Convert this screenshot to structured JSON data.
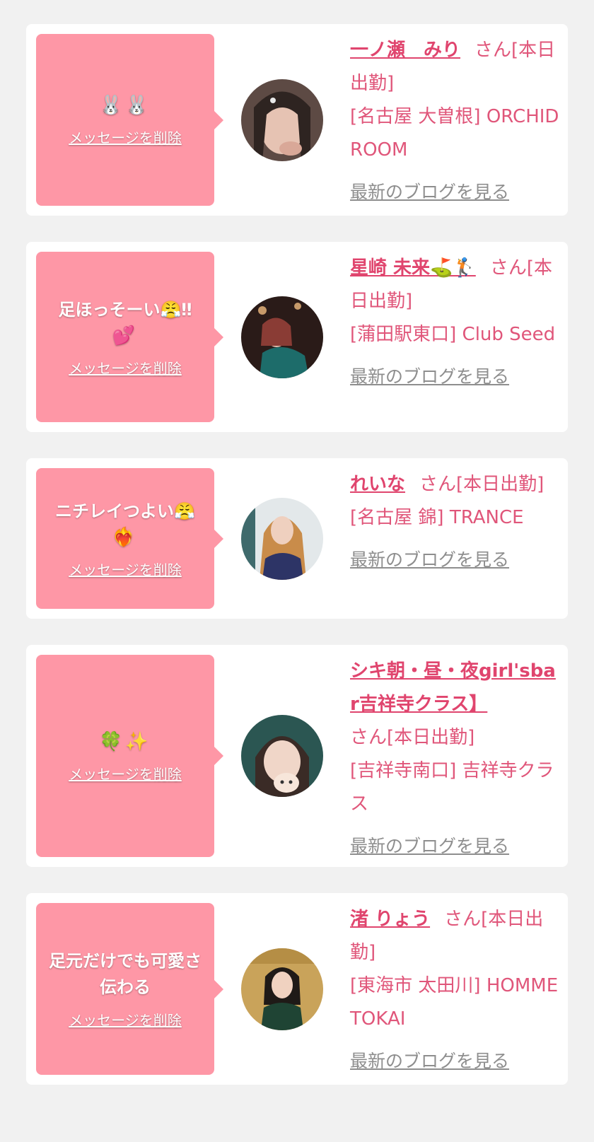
{
  "delete_label": "メッセージを削除",
  "blog_label": "最新のブログを見る",
  "cards": [
    {
      "message": "",
      "emoji": "🐰🐰",
      "name": "一ノ瀬　みり",
      "status": "さん[本日出勤]",
      "location": "[名古屋 大曽根] ORCHID ROOM"
    },
    {
      "message": "足ほっそーい😤‼",
      "emoji": "💕",
      "name": "星崎 未来⛳🏌",
      "status": "さん[本日出勤]",
      "location": "[蒲田駅東口] Club Seed"
    },
    {
      "message": "ニチレイつよい😤",
      "emoji": "❤️‍🔥",
      "name": "れいな",
      "status": "さん[本日出勤]",
      "location": "[名古屋 錦] TRANCE"
    },
    {
      "message": "",
      "emoji": "🍀✨",
      "name": "シキ朝・昼・夜girl'sbar吉祥寺クラス】",
      "status": "さん[本日出勤]",
      "location": "[吉祥寺南口] 吉祥寺クラス"
    },
    {
      "message": "足元だけでも可愛さ伝わる",
      "emoji": "",
      "name": "渚 りょう",
      "status": "さん[本日出勤]",
      "location": "[東海市 太田川] HOMME TOKAI"
    }
  ]
}
